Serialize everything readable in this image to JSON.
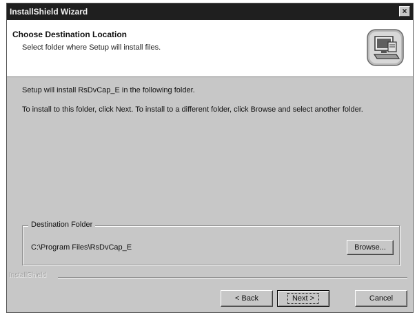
{
  "window": {
    "title": "InstallShield Wizard",
    "close_label": "×"
  },
  "header": {
    "title": "Choose Destination Location",
    "subtitle": "Select folder where Setup will install files."
  },
  "body": {
    "line1": "Setup will install RsDvCap_E in the following folder.",
    "line2": "To install to this folder, click Next. To install to a different folder, click Browse and select another folder."
  },
  "destination": {
    "legend": "Destination Folder",
    "path": "C:\\Program Files\\RsDvCap_E",
    "browse_label": "Browse..."
  },
  "footer": {
    "brand": "InstallShield",
    "back_label": "< Back",
    "next_label": "Next >",
    "cancel_label": "Cancel"
  },
  "icons": {
    "header_icon": "computer-install-icon"
  }
}
